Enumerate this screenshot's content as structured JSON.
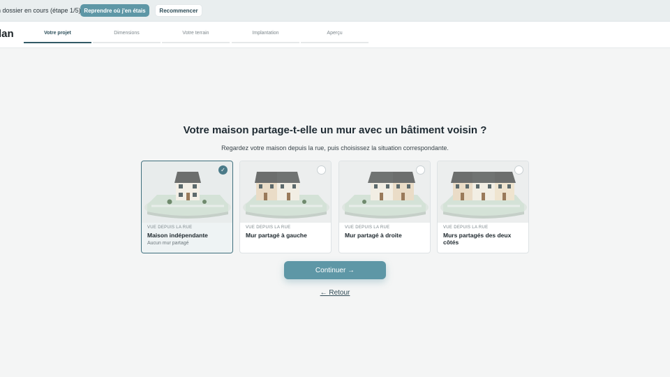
{
  "banner": {
    "text": "n dossier en cours (étape 1/5).",
    "resume_label": "Reprendre où j'en étais",
    "restart_label": "Recommencer"
  },
  "header": {
    "logo": "lan",
    "steps": [
      {
        "label": "Votre projet",
        "active": true
      },
      {
        "label": "Dimensions",
        "active": false
      },
      {
        "label": "Votre terrain",
        "active": false
      },
      {
        "label": "Implantation",
        "active": false
      },
      {
        "label": "Aperçu",
        "active": false
      }
    ]
  },
  "main": {
    "title": "Votre maison partage-t-elle un mur avec un bâtiment voisin ?",
    "subtitle": "Regardez votre maison depuis la rue, puis choisissez la situation correspondante.",
    "options": [
      {
        "kicker": "VUE DEPUIS LA RUE",
        "label": "Maison indépendante",
        "sub": "Aucun mur partagé",
        "selected": true
      },
      {
        "kicker": "VUE DEPUIS LA RUE",
        "label": "Mur partagé à gauche",
        "sub": "",
        "selected": false
      },
      {
        "kicker": "VUE DEPUIS LA RUE",
        "label": "Mur partagé à droite",
        "sub": "",
        "selected": false
      },
      {
        "kicker": "VUE DEPUIS LA RUE",
        "label": "Murs partagés des deux côtés",
        "sub": "",
        "selected": false
      }
    ],
    "continue_label": "Continuer →",
    "back_label": "← Retour"
  },
  "colors": {
    "accent": "#5e97a6",
    "active_step": "#325a66",
    "selected_border": "#3f6f7d"
  }
}
